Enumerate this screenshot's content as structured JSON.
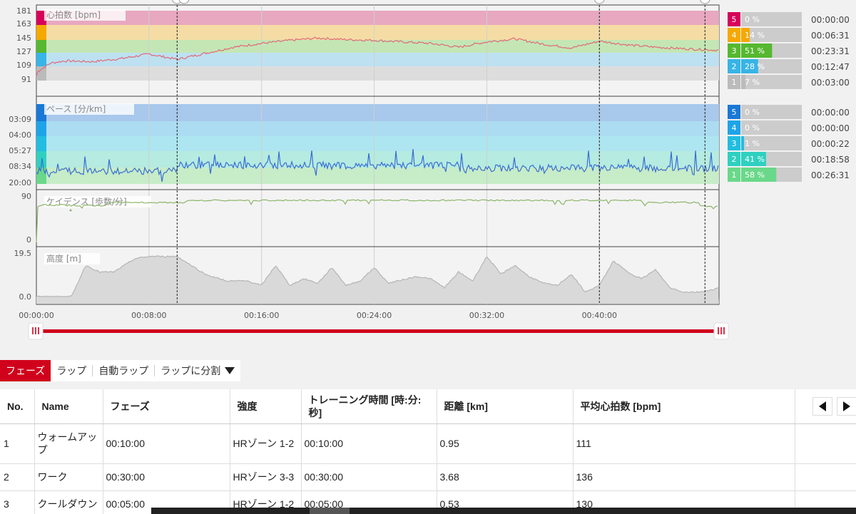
{
  "chart_data": [
    {
      "type": "line",
      "label": "心拍数 [bpm]",
      "yticks": [
        "181",
        "163",
        "145",
        "127",
        "109",
        "91"
      ],
      "ylim": [
        91,
        181
      ],
      "zones": [
        {
          "color": "#e8a8bf",
          "band": "#d6005a"
        },
        {
          "color": "#f5dca5",
          "band": "#f5a800"
        },
        {
          "color": "#c4e6b5",
          "band": "#56b830"
        },
        {
          "color": "#bde1f1",
          "band": "#38b4e6"
        },
        {
          "color": "#dddddd",
          "band": "#bbbbbb"
        }
      ],
      "series": [
        {
          "color": "#e06a78",
          "x_min": [
            0,
            1,
            2,
            4,
            6,
            8,
            10,
            12,
            14,
            16,
            18,
            20,
            22,
            24,
            26,
            28,
            30,
            32,
            34,
            36,
            38,
            40,
            42,
            44,
            46,
            48.5
          ],
          "values": [
            100,
            112,
            115,
            114,
            118,
            124,
            117,
            125,
            133,
            138,
            142,
            145,
            143,
            142,
            140,
            138,
            133,
            140,
            144,
            137,
            132,
            141,
            136,
            133,
            131,
            129
          ]
        }
      ]
    },
    {
      "type": "line",
      "label": "ペース [分/km]",
      "yticks": [
        "03:09",
        "04:00",
        "05:27",
        "08:34",
        "20:00"
      ],
      "zones": [
        {
          "color": "#a8c8ec",
          "band": "#1a78d6"
        },
        {
          "color": "#acdcf2",
          "band": "#1ea4e8"
        },
        {
          "color": "#ade6f0",
          "band": "#22bde0"
        },
        {
          "color": "#b5ebe0",
          "band": "#2fd0c0"
        },
        {
          "color": "#c6ecc8",
          "band": "#6ad88a"
        }
      ],
      "series": [
        {
          "color": "#3a6ed6",
          "pattern": "noisy around zone 2"
        }
      ]
    },
    {
      "type": "line",
      "label": "ケイデンス [歩数/分]",
      "yticks": [
        "90",
        "0"
      ],
      "ylim": [
        0,
        90
      ],
      "series": [
        {
          "color": "#8db56a",
          "values_approx": 83
        }
      ]
    },
    {
      "type": "area",
      "label": "高度 [m]",
      "yticks": [
        "19.5",
        "0.0"
      ],
      "ylim": [
        0,
        19.5
      ],
      "series": [
        {
          "color": "#d9d9d9",
          "stroke": "#b5b5b5",
          "x_min": [
            0,
            2.5,
            3.5,
            4.5,
            5.5,
            7,
            8,
            9,
            10,
            12,
            13.5,
            15,
            16,
            17,
            18,
            19,
            20,
            21,
            22,
            23,
            24,
            25,
            27,
            28,
            29,
            30,
            31,
            32,
            33,
            34,
            35,
            36,
            37,
            38,
            39,
            40,
            41,
            42,
            43,
            44,
            45,
            46,
            47,
            48,
            48.5
          ],
          "values": [
            0,
            0,
            14,
            11,
            11,
            17,
            18,
            18,
            18,
            10,
            7,
            7,
            5,
            14,
            5,
            8,
            6,
            13,
            5,
            7,
            13,
            6,
            9,
            8,
            4,
            11,
            7,
            18,
            10,
            14,
            9,
            6,
            5,
            10,
            2,
            5,
            16,
            11,
            8,
            12,
            4,
            2,
            2,
            3,
            4
          ]
        }
      ]
    }
  ],
  "x_axis": {
    "ticks": [
      "00:00:00",
      "00:08:00",
      "00:16:00",
      "00:24:00",
      "00:32:00",
      "00:40:00"
    ],
    "max_minutes": 48.5
  },
  "hr_zones": [
    {
      "num": "5",
      "pct": "0 %",
      "time": "00:00:00",
      "color": "#d6005a",
      "fill": 0
    },
    {
      "num": "4",
      "pct": "14 %",
      "time": "00:06:31",
      "color": "#f5a800",
      "fill": 0.14
    },
    {
      "num": "3",
      "pct": "51 %",
      "time": "00:23:31",
      "color": "#56b830",
      "fill": 0.51
    },
    {
      "num": "2",
      "pct": "28 %",
      "time": "00:12:47",
      "color": "#38b4e6",
      "fill": 0.28
    },
    {
      "num": "1",
      "pct": "7 %",
      "time": "00:03:00",
      "color": "#bbbbbb",
      "fill": 0.07
    }
  ],
  "pace_zones": [
    {
      "num": "5",
      "pct": "0 %",
      "time": "00:00:00",
      "color": "#1a78d6",
      "fill": 0
    },
    {
      "num": "4",
      "pct": "0 %",
      "time": "00:00:00",
      "color": "#1ea4e8",
      "fill": 0
    },
    {
      "num": "3",
      "pct": "1 %",
      "time": "00:00:22",
      "color": "#22bde0",
      "fill": 0.01
    },
    {
      "num": "2",
      "pct": "41 %",
      "time": "00:18:58",
      "color": "#2fd0c0",
      "fill": 0.41
    },
    {
      "num": "1",
      "pct": "58 %",
      "time": "00:26:31",
      "color": "#6ad88a",
      "fill": 0.58
    }
  ],
  "markers_minutes": [
    10,
    40,
    47.5
  ],
  "tabs": {
    "phase": "フェーズ",
    "lap": "ラップ",
    "auto_lap": "自動ラップ",
    "split": "ラップに分割"
  },
  "table": {
    "headers": {
      "no": "No.",
      "name": "Name",
      "phase": "フェーズ",
      "intensity": "強度",
      "time": "トレーニング時間 [時:分:秒]",
      "distance": "距離 [km]",
      "avg_hr": "平均心拍数 [bpm]"
    },
    "rows": [
      {
        "no": "1",
        "name": "ウォームアップ",
        "phase": "00:10:00",
        "intensity": "HRゾーン 1-2",
        "time": "00:10:00",
        "distance": "0.95",
        "avg_hr": "111"
      },
      {
        "no": "2",
        "name": "ワーク",
        "phase": "00:30:00",
        "intensity": "HRゾーン 3-3",
        "time": "00:30:00",
        "distance": "3.68",
        "avg_hr": "136"
      },
      {
        "no": "3",
        "name": "クールダウン",
        "phase": "00:05:00",
        "intensity": "HRゾーン 1-2",
        "time": "00:05:00",
        "distance": "0.53",
        "avg_hr": "130"
      }
    ]
  }
}
